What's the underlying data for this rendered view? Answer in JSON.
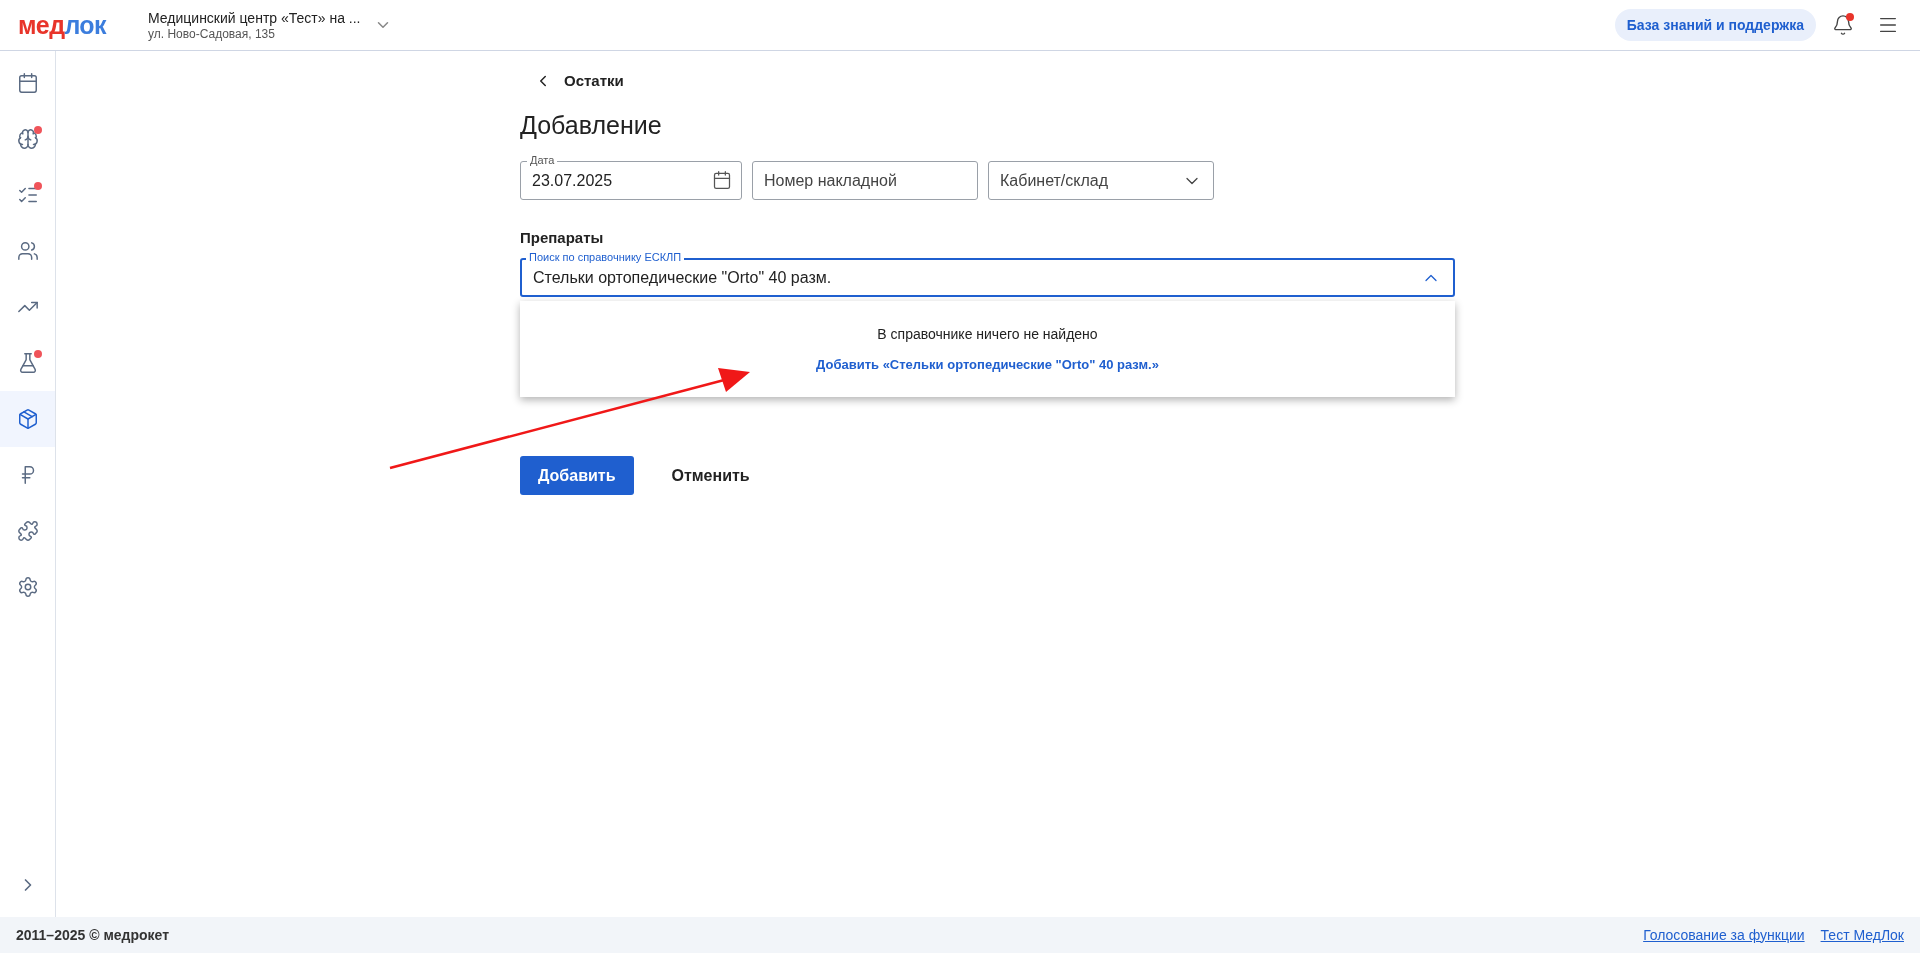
{
  "header": {
    "logo": [
      {
        "text": "мед",
        "color": "#e8342a"
      },
      {
        "text": "лок",
        "color": "#3b7ddd"
      }
    ],
    "clinic": {
      "name": "Медицинский центр «Тест» на ...",
      "address": "ул. Ново-Садовая, 135"
    },
    "support_button": "База знаний и поддержка",
    "notifications": {
      "unread": true
    }
  },
  "sidebar": {
    "items": [
      {
        "selected": false,
        "badge": false
      },
      {
        "selected": false,
        "badge": true
      },
      {
        "selected": false,
        "badge": true
      },
      {
        "selected": false,
        "badge": false
      },
      {
        "selected": false,
        "badge": false
      },
      {
        "selected": false,
        "badge": true
      },
      {
        "selected": true,
        "badge": false
      },
      {
        "selected": false,
        "badge": false
      },
      {
        "selected": false,
        "badge": false
      },
      {
        "selected": false,
        "badge": false
      }
    ]
  },
  "back_link": "Остатки",
  "title": "Добавление",
  "fields": {
    "date": {
      "label": "Дата",
      "value": "23.07.2025"
    },
    "invoice": {
      "placeholder": "Номер накладной"
    },
    "cabinet": {
      "placeholder": "Кабинет/склад"
    }
  },
  "drugs": {
    "heading": "Препараты",
    "search": {
      "label": "Поиск по справочнику ЕСКЛП",
      "value": "Стельки ортопедические \"Orto\" 40 разм.",
      "expanded": true
    },
    "dropdown": {
      "message": "В справочнике ничего не найдено",
      "add_link": "Добавить «Стельки ортопедические \"Orto\" 40 разм.»"
    }
  },
  "buttons": {
    "submit": "Добавить",
    "cancel": "Отменить"
  },
  "footer": {
    "copyright": "2011–2025 © медрокет",
    "links": [
      "Голосование за функции",
      "Тест МедЛок"
    ]
  }
}
